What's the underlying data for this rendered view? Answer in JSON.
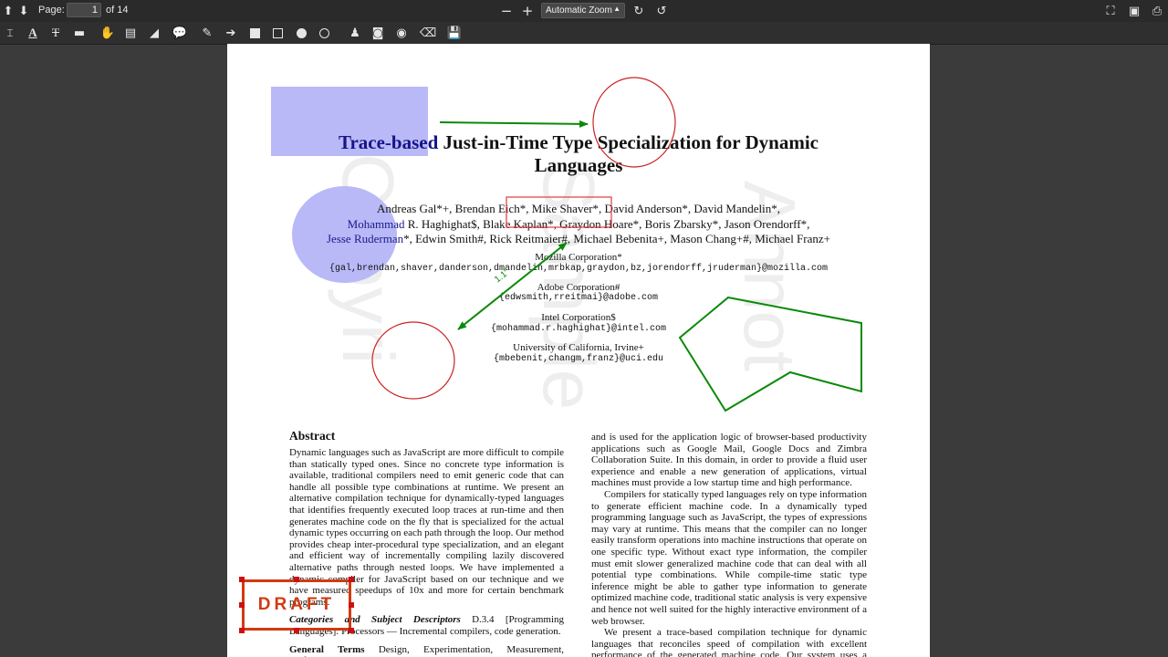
{
  "toolbar": {
    "page_label": "Page:",
    "page_value": "1",
    "page_total": "of 14",
    "zoom_out": "−",
    "zoom_in": "+",
    "zoom_value": "Automatic Zoom"
  },
  "annotation_tools": [
    "text-select-icon",
    "text-icon",
    "strikeout-icon",
    "highlight-icon",
    "hand-icon",
    "note-icon",
    "shape-icon",
    "comment-icon",
    "pen-icon",
    "arrow-icon",
    "filled-rect-icon",
    "rect-icon",
    "filled-circle-icon",
    "circle-icon",
    "stamp-icon",
    "camera-icon",
    "target-icon",
    "eraser-icon",
    "save-icon"
  ],
  "paper": {
    "title_highlight": "Trace-based",
    "title_rest": " Just-in-Time Type Specialization for Dynamic",
    "title_line2": "Languages",
    "authors_line1": "Andreas Gal*+, Brendan Eich*, Mike Shaver*, David Anderson*, David Mandelin*,",
    "authors_line2_blue": "Mohammad",
    "authors_line2_rest": " R. Haghighat$, Blake Kaplan*, Graydon Hoare*, Boris Zbarsky*, Jason Orendorff*,",
    "authors_line3_blue": "Jesse Ruderman",
    "authors_line3_rest": "*, Edwin Smith#, Rick Reitmaier#, Michael Bebenita+, Mason Chang+#, Michael Franz+",
    "affiliations": [
      {
        "name": "Mozilla Corporation*",
        "email": "{gal,brendan,shaver,danderson,dmandelin,mrbkap,graydon,bz,jorendorff,jruderman}@mozilla.com"
      },
      {
        "name": "Adobe Corporation#",
        "email": "{edwsmith,rreitmai}@adobe.com"
      },
      {
        "name": "Intel Corporation$",
        "email": "{mohammad.r.haghighat}@intel.com"
      },
      {
        "name": "University of California, Irvine+",
        "email": "{mbebenit,changm,franz}@uci.edu"
      }
    ],
    "abstract_heading": "Abstract",
    "abstract_text": "Dynamic languages such as JavaScript are more difficult to compile than statically typed ones. Since no concrete type information is available, traditional compilers need to emit generic code that can handle all possible type combinations at runtime. We present an alternative compilation technique for dynamically-typed languages that identifies frequently executed loop traces at run-time and then generates machine code on the fly that is specialized for the actual dynamic types occurring on each path through the loop. Our method provides cheap inter-procedural type specialization, and an elegant and efficient way of incrementally compiling lazily discovered alternative paths through nested loops. We have implemented a dynamic compiler for JavaScript based on our technique and we have measured speedups of 10x and more for certain benchmark programs.",
    "categories_label": "Categories and Subject Descriptors",
    "categories_text": "D.3.4 [Programming Languages]: Processors — Incremental compilers, code generation.",
    "general_label": "General Terms",
    "general_text": "Design, Experimentation, Measurement, Performance.",
    "right_col_p1": "and is used for the application logic of browser-based productivity applications such as Google Mail, Google Docs and Zimbra Collaboration Suite. In this domain, in order to provide a fluid user experience and enable a new generation of applications, virtual machines must provide a low startup time and high performance.",
    "right_col_p2": "Compilers for statically typed languages rely on type information to generate efficient machine code. In a dynamically typed programming language such as JavaScript, the types of expressions may vary at runtime. This means that the compiler can no longer easily transform operations into machine instructions that operate on one specific type. Without exact type information, the compiler must emit slower generalized machine code that can deal with all potential type combinations. While compile-time static type inference might be able to gather type information to generate optimized machine code, traditional static analysis is very expensive and hence not well suited for the highly interactive environment of a web browser.",
    "right_col_p3": "We present a trace-based compilation technique for dynamic languages that reconciles speed of compilation with excellent performance of the generated machine code. Our system uses a mixed-"
  },
  "annotations": {
    "draft_stamp": "DRAFT",
    "arrow_label": "1.1\""
  },
  "colors": {
    "highlight": "#b9b9f8",
    "arrow": "#0a8a0a",
    "circle": "#cc2222",
    "polygon": "#0a8a0a",
    "draft": "#d23a10"
  }
}
